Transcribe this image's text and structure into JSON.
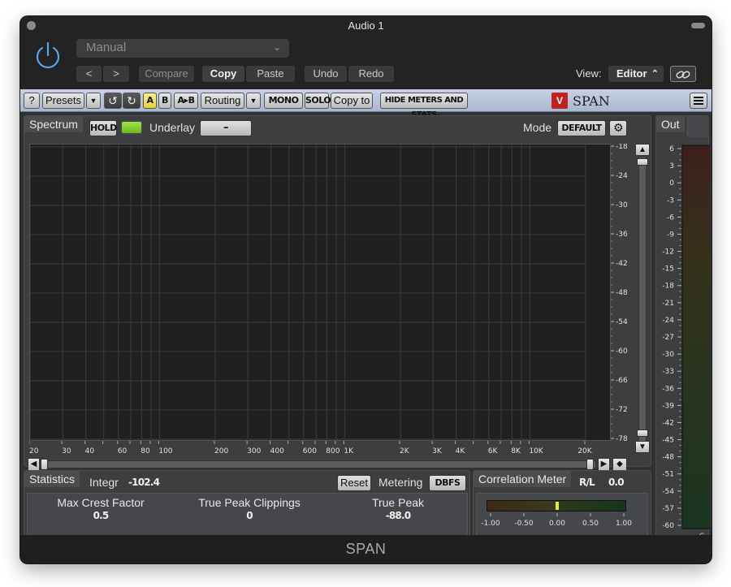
{
  "window": {
    "title": "Audio 1"
  },
  "host": {
    "preset": "Manual",
    "buttons": {
      "compare": "Compare",
      "copy": "Copy",
      "paste": "Paste",
      "undo": "Undo",
      "redo": "Redo"
    },
    "view_label": "View:",
    "view_value": "Editor",
    "prev_icon": "chevron-left-icon",
    "next_icon": "chevron-right-icon"
  },
  "toolbar": {
    "help": "?",
    "presets": "Presets",
    "a": "A",
    "b": "B",
    "a_to_b": "A▸B",
    "routing": "Routing",
    "mono": "MONO",
    "solo": "SOLO",
    "copy_to": "Copy to",
    "hide_meters": "HIDE METERS AND STATS",
    "brand": "SPAN"
  },
  "spectrum": {
    "tab": "Spectrum",
    "hold": "HOLD",
    "underlay_label": "Underlay",
    "underlay_value": "–",
    "mode_label": "Mode",
    "mode_value": "DEFAULT",
    "db_labels": [
      "-18",
      "-24",
      "-30",
      "-36",
      "-42",
      "-48",
      "-54",
      "-60",
      "-66",
      "-72",
      "-78"
    ],
    "freq_labels": [
      "20",
      "30",
      "40",
      "60",
      "80",
      "100",
      "200",
      "300",
      "400",
      "600",
      "800",
      "1K",
      "2K",
      "3K",
      "4K",
      "6K",
      "8K",
      "10K",
      "20K"
    ]
  },
  "out": {
    "tab": "Out",
    "scale": [
      "6",
      "3",
      "0",
      "-3",
      "-6",
      "-9",
      "-12",
      "-15",
      "-18",
      "-21",
      "-24",
      "-27",
      "-30",
      "-33",
      "-36",
      "-39",
      "-42",
      "-45",
      "-48",
      "-51",
      "-54",
      "-57",
      "-60"
    ],
    "channel": "C"
  },
  "statistics": {
    "tab": "Statistics",
    "integr_label": "Integr",
    "integr_value": "-102.4",
    "reset": "Reset",
    "metering_label": "Metering",
    "metering_value": "DBFS",
    "max_crest_label": "Max Crest Factor",
    "max_crest_value": "0.5",
    "tp_clip_label": "True Peak Clippings",
    "tp_clip_value": "0",
    "true_peak_label": "True Peak",
    "true_peak_value": "-88.0"
  },
  "correlation": {
    "tab": "Correlation Meter",
    "channel_label": "R/L",
    "channel_value": "0.0",
    "scale": [
      "-1.00",
      "-0.50",
      "0.00",
      "0.50",
      "1.00"
    ]
  },
  "footer": {
    "brand": "SPAN"
  },
  "colors": {
    "toolbar_bg": "#b4c1d9",
    "led_green": "#8fd83a",
    "logo_red": "#c0201e"
  }
}
